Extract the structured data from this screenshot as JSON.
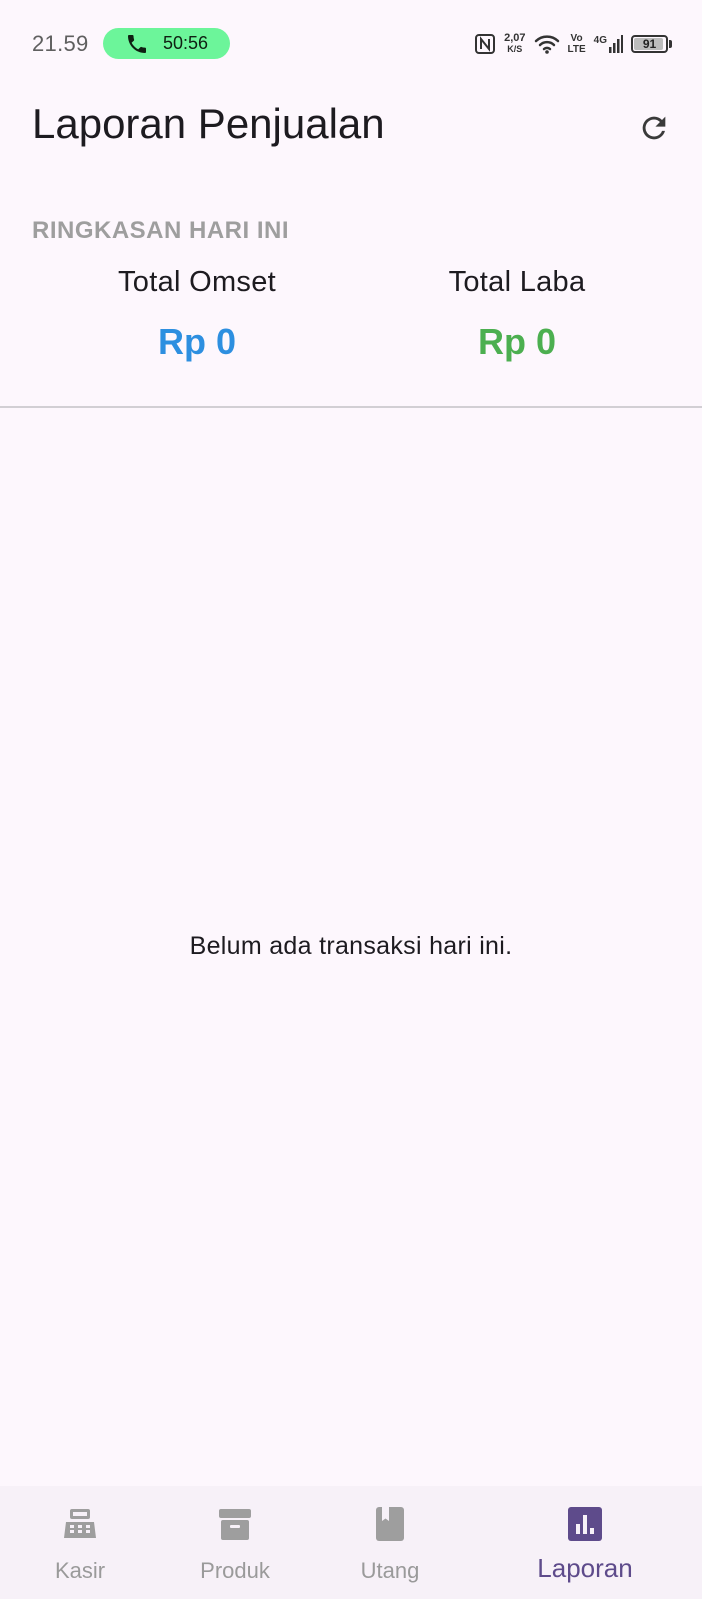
{
  "status_bar": {
    "time": "21.59",
    "call_duration": "50:56",
    "net_speed_value": "2,07",
    "net_speed_unit": "K/S",
    "volte_top": "Vo",
    "volte_bottom": "LTE",
    "network": "4G",
    "battery_level": "91"
  },
  "app_bar": {
    "title": "Laporan Penjualan"
  },
  "summary": {
    "heading": "RINGKASAN HARI INI",
    "omset_label": "Total Omset",
    "omset_value": "Rp 0",
    "laba_label": "Total Laba",
    "laba_value": "Rp 0"
  },
  "empty_message": "Belum ada transaksi hari ini.",
  "bottom_nav": {
    "items": [
      {
        "label": "Kasir",
        "icon": "cash-register-icon"
      },
      {
        "label": "Produk",
        "icon": "archive-box-icon"
      },
      {
        "label": "Utang",
        "icon": "book-icon"
      },
      {
        "label": "Laporan",
        "icon": "bar-chart-icon",
        "active": true
      }
    ]
  },
  "colors": {
    "omset": "#2d8fe0",
    "laba": "#4caf50",
    "active_nav": "#5e4b8b",
    "call_pill": "#6cf59a"
  }
}
